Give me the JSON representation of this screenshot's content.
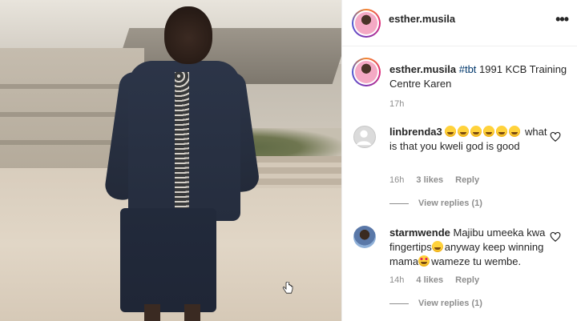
{
  "post": {
    "username": "esther.musila",
    "more_label": "•••"
  },
  "caption": {
    "username": "esther.musila",
    "hashtag": "#tbt",
    "text": " 1991 KCB Training Centre Karen",
    "time": "17h"
  },
  "comments": [
    {
      "username": "linbrenda3",
      "emojis": [
        "😂",
        "😂",
        "😂",
        "😂",
        "😂",
        "😂"
      ],
      "text": "what is that you kweli god is good",
      "time": "16h",
      "likes": "3 likes",
      "reply_label": "Reply",
      "view_replies": "View replies (1)"
    },
    {
      "username": "starmwende",
      "text_a": "Majibu umeeka kwa fingertips",
      "emoji_a": "😂",
      "text_b": "anyway keep winning mama",
      "emoji_b": "😍",
      "text_c": "wameze tu wembe.",
      "time": "14h",
      "likes": "4 likes",
      "reply_label": "Reply",
      "view_replies": "View replies (1)"
    }
  ],
  "icons": {
    "more": "more-options-icon",
    "like": "heart-outline-icon",
    "cursor": "hand-pointer-icon"
  }
}
